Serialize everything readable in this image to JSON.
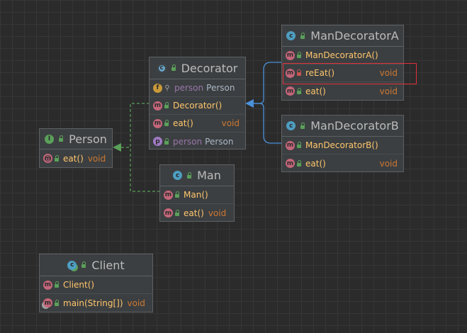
{
  "diagram": {
    "classes": {
      "man_decorator_a": {
        "name": "ManDecoratorA",
        "kind_icon": "class-icon",
        "members": [
          {
            "name": "ManDecoratorA()",
            "type": "",
            "kind": "method",
            "visibility": "public"
          },
          {
            "name": "reEat()",
            "type": "void",
            "kind": "method",
            "visibility": "private"
          },
          {
            "name": "eat()",
            "type": "void",
            "kind": "method",
            "visibility": "public"
          }
        ]
      },
      "decorator": {
        "name": "Decorator",
        "kind_icon": "abstract-class-icon",
        "members": [
          {
            "name": "person",
            "type": "Person",
            "kind": "field",
            "visibility": "package"
          },
          {
            "name": "Decorator()",
            "type": "",
            "kind": "method",
            "visibility": "public"
          },
          {
            "name": "eat()",
            "type": "void",
            "kind": "method",
            "visibility": "public"
          },
          {
            "name": "person",
            "type": "Person",
            "kind": "property",
            "visibility": "public"
          }
        ]
      },
      "man_decorator_b": {
        "name": "ManDecoratorB",
        "kind_icon": "class-icon",
        "members": [
          {
            "name": "ManDecoratorB()",
            "type": "",
            "kind": "method",
            "visibility": "public"
          },
          {
            "name": "eat()",
            "type": "void",
            "kind": "method",
            "visibility": "public"
          }
        ]
      },
      "person": {
        "name": "Person",
        "kind_icon": "interface-icon",
        "members": [
          {
            "name": "eat()",
            "type": "void",
            "kind": "method",
            "visibility": "public"
          }
        ]
      },
      "man": {
        "name": "Man",
        "kind_icon": "class-icon",
        "members": [
          {
            "name": "Man()",
            "type": "",
            "kind": "method",
            "visibility": "public"
          },
          {
            "name": "eat()",
            "type": "void",
            "kind": "method",
            "visibility": "public"
          }
        ]
      },
      "client": {
        "name": "Client",
        "kind_icon": "class-icon",
        "members": [
          {
            "name": "Client()",
            "type": "",
            "kind": "method",
            "visibility": "public"
          },
          {
            "name": "main(String[])",
            "type": "void",
            "kind": "method",
            "visibility": "public"
          }
        ]
      }
    },
    "icon_letters": {
      "class": "c",
      "interface": "I",
      "method": "m",
      "field": "f",
      "property": "p"
    },
    "relations": [
      {
        "from": "Decorator",
        "to": "Person",
        "kind": "realization"
      },
      {
        "from": "Man",
        "to": "Person",
        "kind": "realization"
      },
      {
        "from": "ManDecoratorA",
        "to": "Decorator",
        "kind": "generalization"
      },
      {
        "from": "ManDecoratorB",
        "to": "Decorator",
        "kind": "generalization"
      }
    ],
    "highlight_member": "reEat()",
    "colors": {
      "background": "#2b2b2b",
      "grid": "#363636",
      "node_fill": "#3c3f41",
      "node_border": "#5e6163",
      "title_text": "#bbbbbb",
      "method_name": "#ffc66d",
      "field_name": "#9876aa",
      "return_type": "#cc7832",
      "class_type": "#a9b7c6",
      "realization_line": "#5aa05a",
      "generalization_line": "#4a90d9",
      "highlight_box": "#e0303a"
    }
  }
}
